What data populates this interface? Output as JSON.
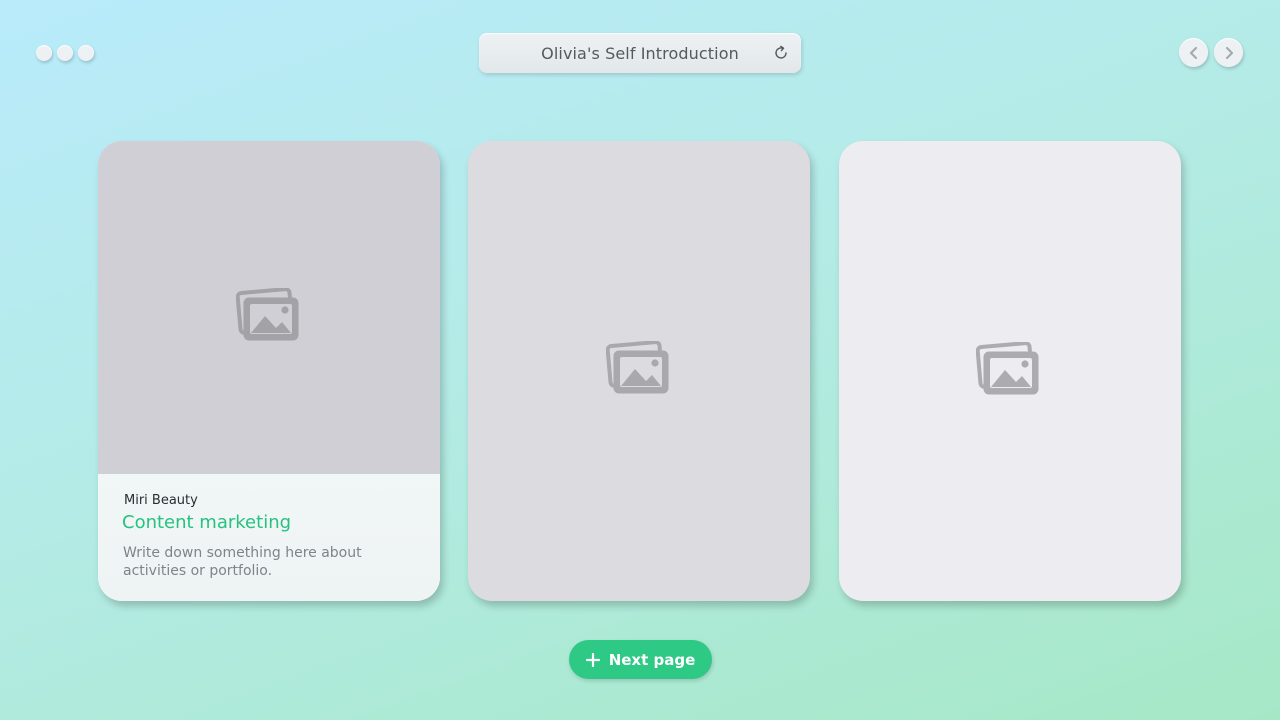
{
  "window": {
    "title": "Olivia's Self Introduction"
  },
  "cards": [
    {
      "company": "Miri Beauty",
      "role": "Content marketing",
      "description": "Write down something here about activities or portfolio."
    }
  ],
  "footer": {
    "next_label": "Next page"
  },
  "colors": {
    "accent": "#2dc985",
    "role_text": "#27c27f"
  },
  "icons": {
    "refresh": "refresh-icon",
    "prev": "chevron-left-icon",
    "next": "chevron-right-icon",
    "image": "image-placeholder-icon",
    "plus": "plus-icon"
  }
}
